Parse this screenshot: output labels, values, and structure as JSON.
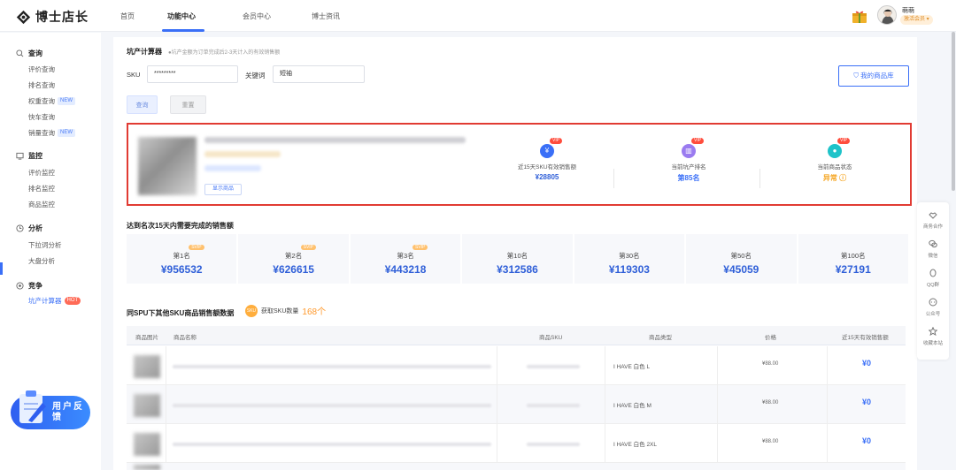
{
  "brand": {
    "name": "博士店长"
  },
  "nav": [
    "首页",
    "功能中心",
    "会员中心",
    "博士资讯"
  ],
  "user": {
    "name": "萌萌",
    "badge": "激活会员 ▾"
  },
  "sidebar": {
    "groups": [
      {
        "title": "查询",
        "items": [
          {
            "label": "评价查询"
          },
          {
            "label": "排名查询"
          },
          {
            "label": "权重查询",
            "tag": "NEW"
          },
          {
            "label": "快车查询"
          },
          {
            "label": "销量查询",
            "tag": "NEW"
          }
        ]
      },
      {
        "title": "监控",
        "items": [
          {
            "label": "评价监控"
          },
          {
            "label": "排名监控"
          },
          {
            "label": "商品监控"
          }
        ]
      },
      {
        "title": "分析",
        "items": [
          {
            "label": "下拉词分析"
          },
          {
            "label": "大盘分析"
          }
        ]
      },
      {
        "title": "竞争",
        "items": [
          {
            "label": "坑产计算器",
            "tag": "HOT"
          }
        ]
      }
    ],
    "feedback": "用户反馈"
  },
  "calc": {
    "title": "坑产计算器",
    "note": "●坑产金额为订单完成后2-3天计入的有效销售额",
    "sku_label": "SKU",
    "sku_value": "*********",
    "keyword_label": "关键词",
    "keyword_value": "短袖",
    "btn_search": "查询",
    "btn_reset": "重置",
    "btn_mine": "我的商品库"
  },
  "product": {
    "show_btn": "显示商品",
    "metrics": [
      {
        "label": "近15天SKU有效销售额",
        "value": "¥28805",
        "vip": "VIP",
        "icon": "¥"
      },
      {
        "label": "当前坑产排名",
        "value": "第85名",
        "vip": "VIP",
        "icon": "▥"
      },
      {
        "label": "当前商品状态",
        "value": "异常 ⓘ",
        "vip": "VIP",
        "icon": "●"
      }
    ]
  },
  "ranks": {
    "title": "达到名次15天内需要完成的销售额",
    "vip": "SVIP",
    "items": [
      {
        "name": "第1名",
        "value": "¥956532",
        "vip": true
      },
      {
        "name": "第2名",
        "value": "¥626615",
        "vip": true
      },
      {
        "name": "第3名",
        "value": "¥443218",
        "vip": true
      },
      {
        "name": "第10名",
        "value": "¥312586",
        "vip": false
      },
      {
        "name": "第30名",
        "value": "¥119303",
        "vip": false
      },
      {
        "name": "第50名",
        "value": "¥45059",
        "vip": false
      },
      {
        "name": "第100名",
        "value": "¥27191",
        "vip": false
      }
    ]
  },
  "spu": {
    "title": "同SPU下其他SKU商品销售额数据",
    "sku_icon": "SKU",
    "count_label": "获取SKU数量",
    "count": "168个",
    "headers": [
      "商品图片",
      "商品名称",
      "商品SKU",
      "商品类型",
      "价格",
      "近15天有效销售额"
    ],
    "rows": [
      {
        "type": "I HAVE 白色  L",
        "price": "¥88.00",
        "sales": "¥0"
      },
      {
        "type": "I HAVE 白色  M",
        "price": "¥88.00",
        "sales": "¥0"
      },
      {
        "type": "I HAVE 白色  2XL",
        "price": "¥88.00",
        "sales": "¥0"
      }
    ]
  },
  "toolbar": [
    "商务合作",
    "微信",
    "QQ群",
    "公众号",
    "收藏本站"
  ],
  "colors": {
    "accent": "#3a6ff7",
    "alert_border": "#e13b33",
    "rank_value": "#2f5fd8",
    "status_warn": "#f5a623"
  }
}
